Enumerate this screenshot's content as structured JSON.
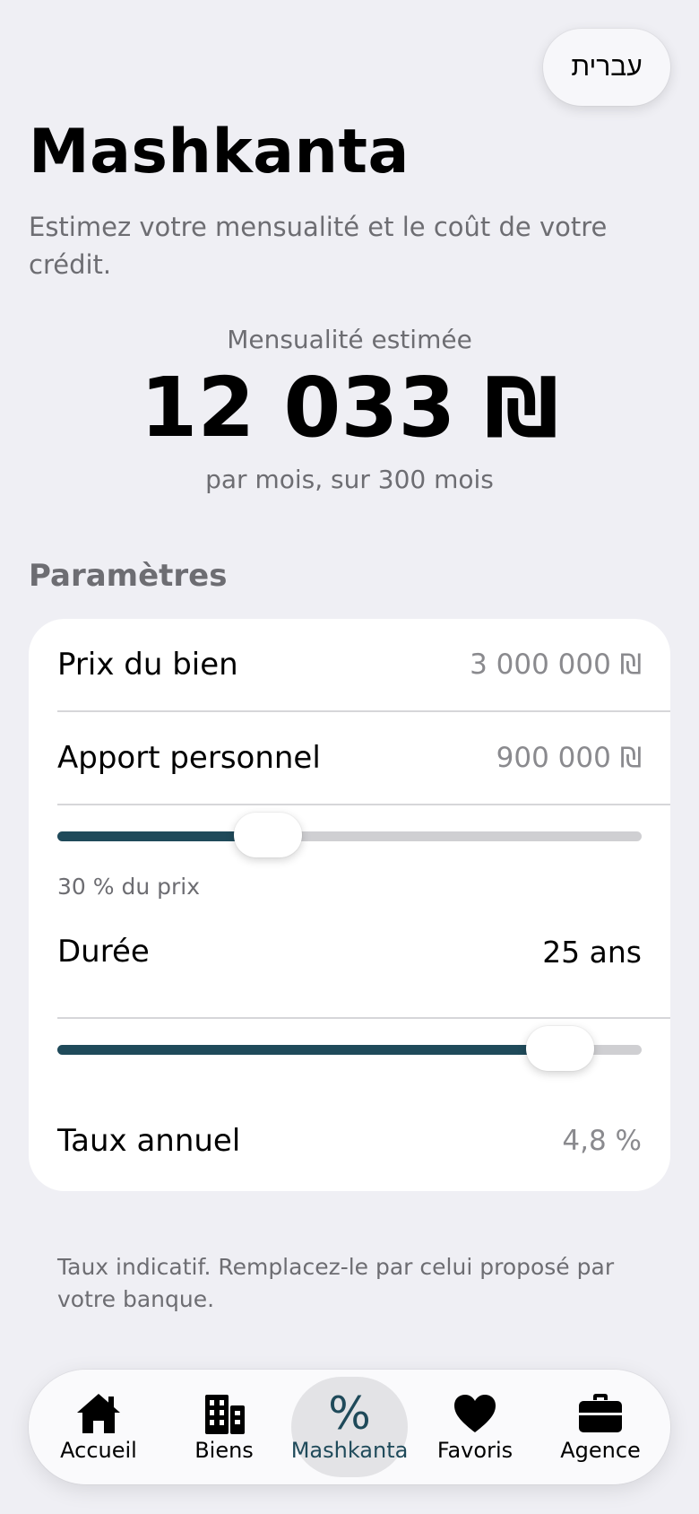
{
  "header": {
    "language_button": "עברית",
    "title": "Mashkanta",
    "subtitle": "Estimez votre mensualité et le coût de votre crédit."
  },
  "estimate": {
    "label": "Mensualité estimée",
    "amount": "12 033 ₪",
    "sub": "par mois, sur 300 mois"
  },
  "parameters": {
    "heading": "Paramètres",
    "price": {
      "label": "Prix du bien",
      "value": "3 000 000 ₪"
    },
    "down_payment": {
      "label": "Apport personnel",
      "value": "900 000 ₪",
      "slider_level_pct": 36,
      "caption": "30 % du prix"
    },
    "duration": {
      "label": "Durée",
      "value": "25 ans",
      "slider_level_pct": 86
    },
    "rate": {
      "label": "Taux annuel",
      "value": "4,8 %"
    }
  },
  "note": "Taux indicatif. Remplacez-le par celui proposé par votre banque.",
  "tabbar": {
    "tabs": [
      {
        "label": "Accueil",
        "icon": "house-icon"
      },
      {
        "label": "Biens",
        "icon": "building-icon"
      },
      {
        "label": "Mashkanta",
        "icon": "percent-icon",
        "active": true
      },
      {
        "label": "Favoris",
        "icon": "heart-icon"
      },
      {
        "label": "Agence",
        "icon": "briefcase-icon"
      }
    ]
  },
  "colors": {
    "accent": "#1f4a5a",
    "background": "#efeff4",
    "card": "#ffffff"
  }
}
